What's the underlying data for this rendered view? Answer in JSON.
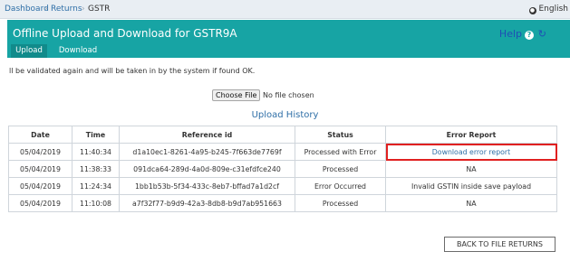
{
  "breadcrumb": {
    "items": [
      "Dashboard",
      "Returns",
      "GSTR"
    ],
    "separator": "›"
  },
  "language": {
    "label": "English"
  },
  "header": {
    "title": "Offline Upload and Download for GSTR9A",
    "help_label": "Help",
    "tabs": [
      "Upload",
      "Download"
    ],
    "color": "#17a4a4"
  },
  "info_text": "ll be validated again and will be taken in by the system if found OK.",
  "file": {
    "button_label": "Choose File",
    "status": "No file chosen"
  },
  "history": {
    "title": "Upload History",
    "columns": [
      "Date",
      "Time",
      "Reference id",
      "Status",
      "Error Report"
    ],
    "rows": [
      [
        "05/04/2019",
        "11:40:34",
        "d1a10ec1-8261-4a95-b245-7f663de7769f",
        "Processed with Error",
        "Download error report"
      ],
      [
        "05/04/2019",
        "11:38:33",
        "091dca64-289d-4a0d-809e-c31efdfce240",
        "Processed",
        "NA"
      ],
      [
        "05/04/2019",
        "11:24:34",
        "1bb1b53b-5f34-433c-8eb7-bffad7a1d2cf",
        "Error Occurred",
        "Invalid GSTIN inside save payload"
      ],
      [
        "05/04/2019",
        "11:10:08",
        "a7f32f77-b9d9-42a3-8db8-b9d7ab951663",
        "Processed",
        "NA"
      ]
    ]
  },
  "back_button": {
    "label": "BACK TO FILE RETURNS"
  }
}
